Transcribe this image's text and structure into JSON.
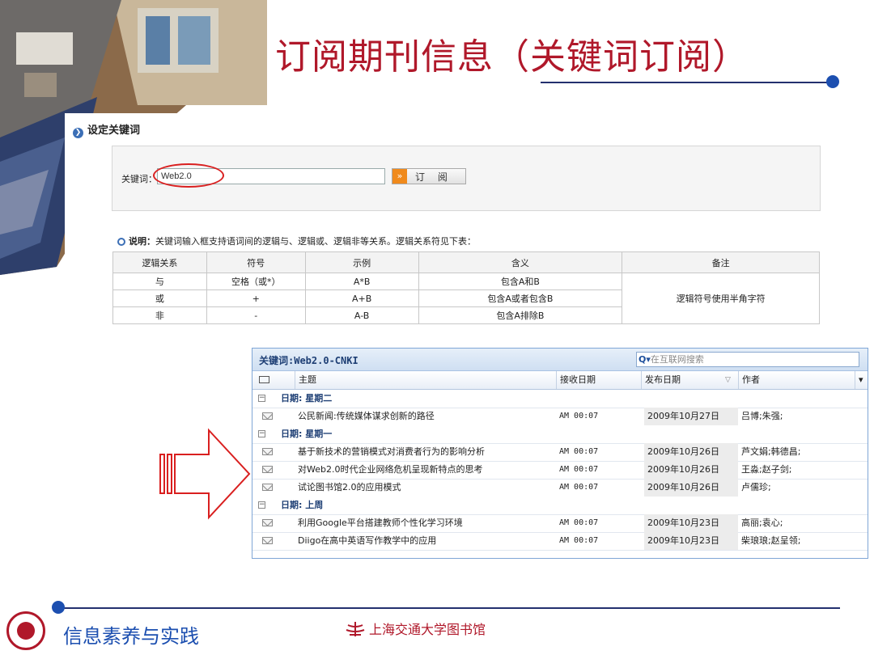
{
  "slide": {
    "title": "订阅期刊信息（关键词订阅）",
    "footer_text": "信息素养与实践",
    "library_name": "上海交通大学图书馆"
  },
  "keyword_panel": {
    "heading": "设定关键词",
    "keyword_label": "关键词：",
    "keyword_value": "Web2.0",
    "subscribe_icon": "»",
    "subscribe_label": "订 阅"
  },
  "note": {
    "label": "说明：",
    "text": "关键词输入框支持语词间的逻辑与、逻辑或、逻辑非等关系。逻辑关系符见下表："
  },
  "logic_table": {
    "headers": [
      "逻辑关系",
      "符号",
      "示例",
      "含义",
      "备注"
    ],
    "rows": [
      [
        "与",
        "空格（或*）",
        "A*B",
        "包含A和B"
      ],
      [
        "或",
        "+",
        "A+B",
        "包含A或者包含B"
      ],
      [
        "非",
        "-",
        "A-B",
        "包含A排除B"
      ]
    ],
    "remark": "逻辑符号使用半角字符"
  },
  "mail": {
    "title": "关键词:Web2.0-CNKI",
    "search_placeholder": "在互联网搜索",
    "columns": [
      "主题",
      "接收日期",
      "发布日期",
      "作者"
    ],
    "groups": [
      {
        "label": "日期: 星期二",
        "items": [
          {
            "subject": "公民新闻:传统媒体谋求创新的路径",
            "received": "AM 00:07",
            "published": "2009年10月27日",
            "author": "吕博;朱强;"
          }
        ]
      },
      {
        "label": "日期: 星期一",
        "items": [
          {
            "subject": "基于新技术的营销模式对消费者行为的影响分析",
            "received": "AM 00:07",
            "published": "2009年10月26日",
            "author": "芦文娟;韩德昌;"
          },
          {
            "subject": "对Web2.0时代企业网络危机呈现新特点的思考",
            "received": "AM 00:07",
            "published": "2009年10月26日",
            "author": "王淼;赵子剑;"
          },
          {
            "subject": "试论图书馆2.0的应用模式",
            "received": "AM 00:07",
            "published": "2009年10月26日",
            "author": "卢儒珍;"
          }
        ]
      },
      {
        "label": "日期: 上周",
        "items": [
          {
            "subject": "利用Google平台搭建教师个性化学习环境",
            "received": "AM 00:07",
            "published": "2009年10月23日",
            "author": "高丽;袁心;"
          },
          {
            "subject": "Diigo在高中英语写作教学中的应用",
            "received": "AM 00:07",
            "published": "2009年10月23日",
            "author": "柴琅琅;赵呈领;"
          }
        ]
      }
    ]
  },
  "colors": {
    "title": "#b0182a",
    "accent": "#1c4fb0",
    "arrow": "#d91f1f"
  }
}
